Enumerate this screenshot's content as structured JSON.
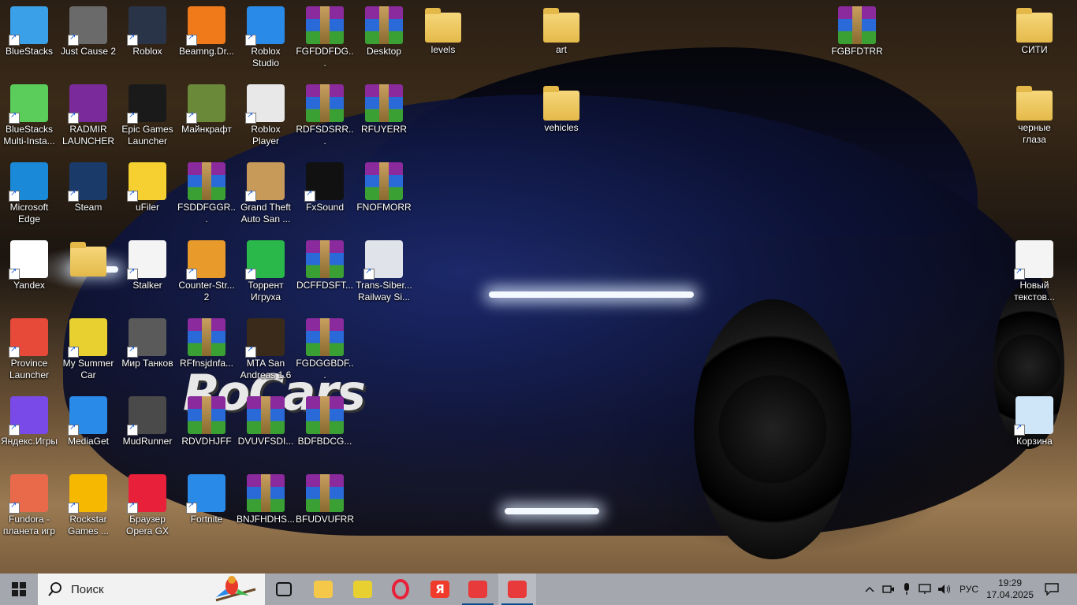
{
  "desktop": {
    "watermark": "RoCars",
    "icons": [
      {
        "label": "BlueStacks",
        "icon": "bluestacks-icon",
        "color": "#3aa0e8",
        "kind": "app"
      },
      {
        "label": "Just Cause 2",
        "icon": "just-cause-2-icon",
        "color": "#6a6a6a",
        "kind": "app"
      },
      {
        "label": "Roblox",
        "icon": "roblox-icon",
        "color": "#2a3448",
        "kind": "app"
      },
      {
        "label": "Beamng.Dr...",
        "icon": "beamng-icon",
        "color": "#f07a1a",
        "kind": "app"
      },
      {
        "label": "Roblox Studio",
        "icon": "roblox-studio-icon",
        "color": "#2a8ae8",
        "kind": "app"
      },
      {
        "label": "FGFDDFDG...",
        "icon": "archive-icon",
        "kind": "archive"
      },
      {
        "label": "Desktop",
        "icon": "archive-icon",
        "kind": "archive"
      },
      {
        "label": "levels",
        "icon": "folder-icon",
        "kind": "folder"
      },
      {
        "label": "art",
        "icon": "folder-icon",
        "kind": "folder"
      },
      {
        "label": "FGBFDTRR",
        "icon": "archive-icon",
        "kind": "archive"
      },
      {
        "label": "СИТИ",
        "icon": "folder-icon",
        "kind": "folder"
      },
      {
        "label": "BlueStacks Multi-Insta...",
        "icon": "bluestacks-multi-icon",
        "color": "#5acd5a",
        "kind": "app"
      },
      {
        "label": "RADMIR LAUNCHER",
        "icon": "radmir-icon",
        "color": "#7a2a9a",
        "kind": "app"
      },
      {
        "label": "Epic Games Launcher",
        "icon": "epic-games-icon",
        "color": "#1a1a1a",
        "kind": "app"
      },
      {
        "label": "Майнкрафт",
        "icon": "minecraft-icon",
        "color": "#6a8a3a",
        "kind": "app"
      },
      {
        "label": "Roblox Player",
        "icon": "roblox-player-icon",
        "color": "#e8e8e8",
        "kind": "app"
      },
      {
        "label": "RDFSDSRR...",
        "icon": "archive-icon",
        "kind": "archive"
      },
      {
        "label": "RFUYERR",
        "icon": "archive-icon",
        "kind": "archive"
      },
      {
        "label": "vehicles",
        "icon": "folder-icon",
        "kind": "folder"
      },
      {
        "label": "черные глаза",
        "icon": "folder-icon",
        "kind": "folder"
      },
      {
        "label": "Microsoft Edge",
        "icon": "edge-icon",
        "color": "#1a8ad8",
        "kind": "app"
      },
      {
        "label": "Steam",
        "icon": "steam-icon",
        "color": "#1a3a6a",
        "kind": "app"
      },
      {
        "label": "uFiler",
        "icon": "ufiler-icon",
        "color": "#f6d030",
        "kind": "app"
      },
      {
        "label": "FSDDFGGR...",
        "icon": "archive-icon",
        "kind": "archive"
      },
      {
        "label": "Grand Theft Auto San ...",
        "icon": "gta-sa-icon",
        "color": "#c89a5a",
        "kind": "app"
      },
      {
        "label": "FxSound",
        "icon": "fxsound-icon",
        "color": "#111111",
        "kind": "app"
      },
      {
        "label": "FNOFMORR",
        "icon": "archive-icon",
        "kind": "archive"
      },
      {
        "label": "Yandex",
        "icon": "yandex-icon",
        "color": "#ffffff",
        "kind": "app"
      },
      {
        "label": "",
        "icon": "folder-icon",
        "kind": "folder"
      },
      {
        "label": "Stalker",
        "icon": "file-icon",
        "color": "#f4f4f4",
        "kind": "app"
      },
      {
        "label": "Counter-Str... 2",
        "icon": "counter-strike-icon",
        "color": "#e89a2a",
        "kind": "app"
      },
      {
        "label": "Торрент Игруха",
        "icon": "torrent-igruha-icon",
        "color": "#2ab84a",
        "kind": "app"
      },
      {
        "label": "DCFFDSFT...",
        "icon": "archive-icon",
        "kind": "archive"
      },
      {
        "label": "Trans-Siber... Railway Si...",
        "icon": "trans-siberian-icon",
        "color": "#e0e4ea",
        "kind": "app"
      },
      {
        "label": "Новый текстов...",
        "icon": "text-file-icon",
        "color": "#f4f4f4",
        "kind": "app"
      },
      {
        "label": "Province Launcher",
        "icon": "province-icon",
        "color": "#e84a3a",
        "kind": "app"
      },
      {
        "label": "My Summer Car",
        "icon": "my-summer-car-icon",
        "color": "#e8d030",
        "kind": "app"
      },
      {
        "label": "Мир Танков",
        "icon": "mir-tankov-icon",
        "color": "#5a5a5a",
        "kind": "app"
      },
      {
        "label": "RFfnsjdnfa...",
        "icon": "archive-icon",
        "kind": "archive"
      },
      {
        "label": "MTA San Andreas 1.6",
        "icon": "mta-icon",
        "color": "#3a2a1a",
        "kind": "app"
      },
      {
        "label": "FGDGGBDF...",
        "icon": "archive-icon",
        "kind": "archive"
      },
      {
        "label": "Яндекс.Игры",
        "icon": "yandex-games-icon",
        "color": "#7a4ae8",
        "kind": "app"
      },
      {
        "label": "MediaGet",
        "icon": "mediaget-icon",
        "color": "#2a8ae8",
        "kind": "app"
      },
      {
        "label": "MudRunner",
        "icon": "mudrunner-icon",
        "color": "#4a4a4a",
        "kind": "app"
      },
      {
        "label": "RDVDHJFF",
        "icon": "archive-icon",
        "kind": "archive"
      },
      {
        "label": "DVUVFSDI...",
        "icon": "archive-icon",
        "kind": "archive"
      },
      {
        "label": "BDFBDCG...",
        "icon": "archive-icon",
        "kind": "archive"
      },
      {
        "label": "Корзина",
        "icon": "recycle-bin-icon",
        "color": "#cfe6f8",
        "kind": "app"
      },
      {
        "label": "Fundora - планета игр",
        "icon": "fundora-icon",
        "color": "#e86a4a",
        "kind": "app"
      },
      {
        "label": "Rockstar Games ...",
        "icon": "rockstar-icon",
        "color": "#f6b800",
        "kind": "app"
      },
      {
        "label": "Браузер Opera GX",
        "icon": "opera-gx-icon",
        "color": "#e8203a",
        "kind": "app"
      },
      {
        "label": "Fortnite",
        "icon": "fortnite-icon",
        "color": "#2a8ae8",
        "kind": "app"
      },
      {
        "label": "BNJFHDHS...",
        "icon": "archive-icon",
        "kind": "archive"
      },
      {
        "label": "BFUDVUFRR",
        "icon": "archive-icon",
        "kind": "archive"
      }
    ]
  },
  "taskbar": {
    "search_placeholder": "Поиск",
    "pinned": [
      {
        "name": "task-view",
        "icon": "task-view-icon"
      },
      {
        "name": "file-explorer",
        "icon": "folder-icon",
        "color": "#f6c84a"
      },
      {
        "name": "my-summer-car",
        "icon": "my-summer-car-icon",
        "color": "#e8d030"
      },
      {
        "name": "opera",
        "icon": "opera-icon",
        "color": "#e8203a"
      },
      {
        "name": "yandex",
        "icon": "yandex-icon",
        "color": "#f03a2a",
        "glyph": "Я"
      },
      {
        "name": "cloud-app",
        "icon": "cloud-icon",
        "color": "#e83a3a"
      },
      {
        "name": "cloud-app-2",
        "icon": "cloud-icon",
        "color": "#e83a3a"
      }
    ],
    "tray": {
      "language": "РУС",
      "time": "19:29",
      "date": "17.04.2025"
    }
  }
}
